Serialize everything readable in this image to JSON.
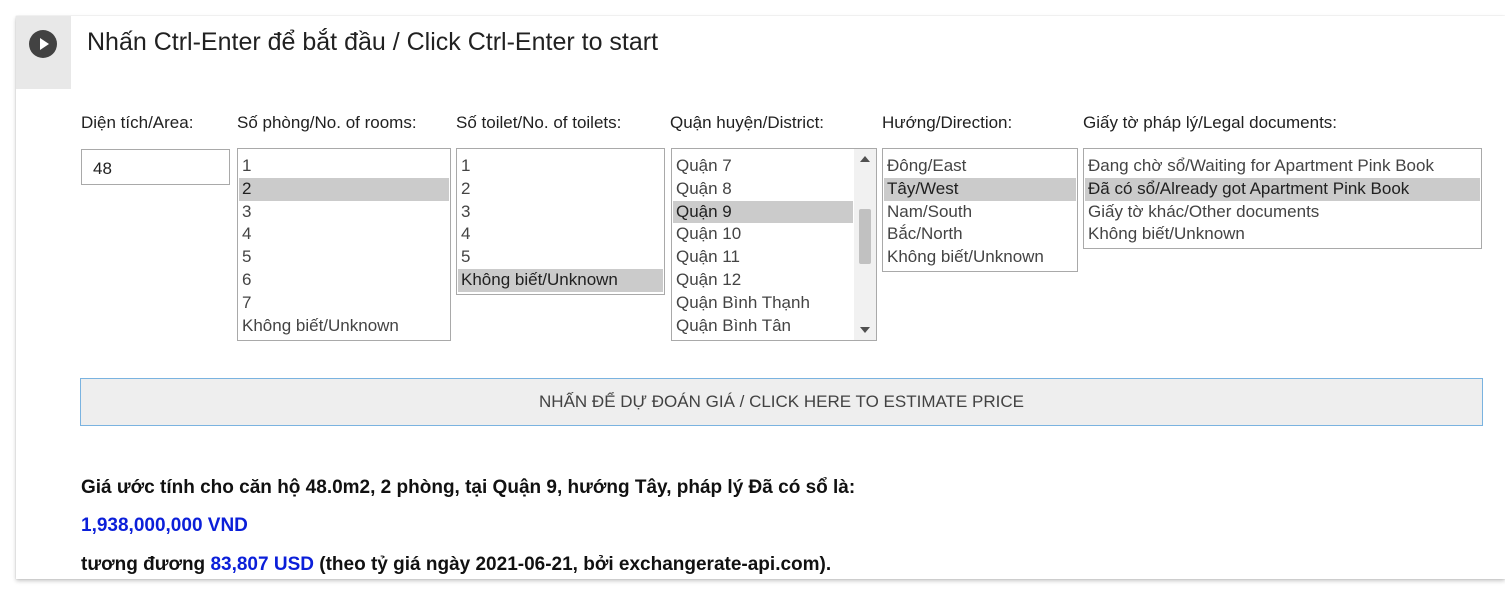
{
  "header": {
    "run_icon": "play-circle-icon",
    "title": "Nhấn Ctrl-Enter để bắt đầu / Click Ctrl-Enter to start"
  },
  "fields": {
    "area": {
      "label": "Diện tích/Area:",
      "value": "48"
    },
    "rooms": {
      "label": "Số phòng/No. of rooms:",
      "options": [
        "1",
        "2",
        "3",
        "4",
        "5",
        "6",
        "7",
        "Không biết/Unknown"
      ],
      "selected": "2"
    },
    "toilets": {
      "label": "Số toilet/No. of toilets:",
      "options": [
        "1",
        "2",
        "3",
        "4",
        "5",
        "Không biết/Unknown"
      ],
      "selected": "Không biết/Unknown"
    },
    "district": {
      "label": "Quận huyện/District:",
      "options": [
        "Quận 7",
        "Quận 8",
        "Quận 9",
        "Quận 10",
        "Quận 11",
        "Quận 12",
        "Quận Bình Thạnh",
        "Quận Bình Tân"
      ],
      "selected": "Quận 9"
    },
    "direction": {
      "label": "Hướng/Direction:",
      "options": [
        "Đông/East",
        "Tây/West",
        "Nam/South",
        "Bắc/North",
        "Không biết/Unknown"
      ],
      "selected": "Tây/West"
    },
    "legal": {
      "label": "Giấy tờ pháp lý/Legal documents:",
      "options": [
        "Đang chờ sổ/Waiting for Apartment Pink Book",
        "Đã có sổ/Already got Apartment Pink Book",
        "Giấy tờ khác/Other documents",
        "Không biết/Unknown"
      ],
      "selected": "Đã có sổ/Already got Apartment Pink Book"
    }
  },
  "estimate_button": {
    "label": "NHẤN ĐỂ DỰ ĐOÁN GIÁ / CLICK HERE TO ESTIMATE PRICE"
  },
  "result": {
    "summary": "Giá ước tính cho căn hộ 48.0m2, 2 phòng, tại Quận 9, hướng Tây, pháp lý Đã có sổ là:",
    "price_vnd": "1,938,000,000 VND",
    "usd_prefix": "tương đương ",
    "price_usd": "83,807 USD",
    "usd_suffix": " (theo tỷ giá ngày 2021-06-21, bởi exchangerate-api.com)."
  },
  "colors": {
    "accent_blue": "#0b1fd9",
    "selected_option": "#cbcbcb",
    "button_border": "#7ab3e0"
  }
}
